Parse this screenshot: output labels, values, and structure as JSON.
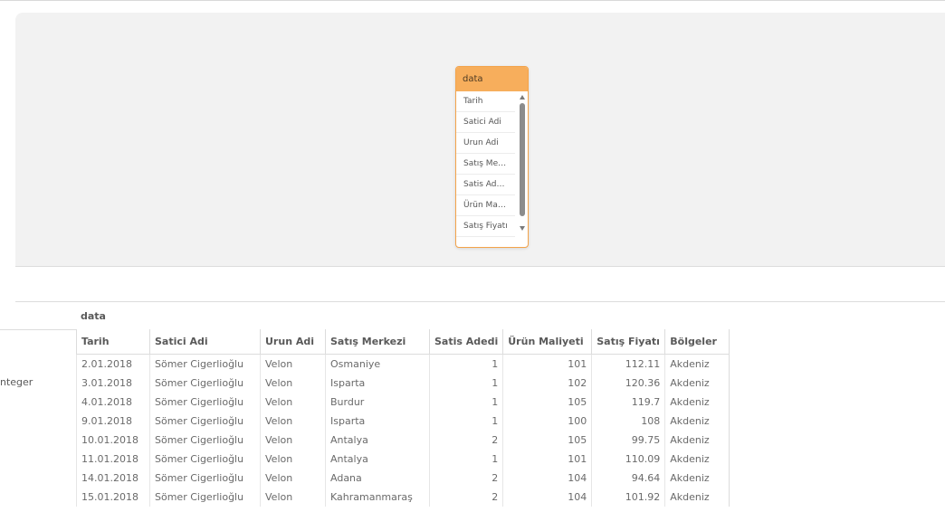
{
  "model_viewer": {
    "table": {
      "name": "data",
      "fields": [
        "Tarih",
        "Satici Adi",
        "Urun Adi",
        "Satış Me…",
        "Satis Ad…",
        "Ürün Ma…",
        "Satış Fiyatı"
      ]
    }
  },
  "preview": {
    "field_type": "nteger",
    "table_name": "data",
    "columns": [
      "Tarih",
      "Satici Adi",
      "Urun Adi",
      "Satış Merkezi",
      "Satis Adedi",
      "Ürün Maliyeti",
      "Satış Fiyatı",
      "Bölgeler"
    ],
    "rows": [
      [
        "2.01.2018",
        "Sömer Cigerlioğlu",
        "Velon",
        "Osmaniye",
        "1",
        "101",
        "112.11",
        "Akdeniz"
      ],
      [
        "3.01.2018",
        "Sömer Cigerlioğlu",
        "Velon",
        "Isparta",
        "1",
        "102",
        "120.36",
        "Akdeniz"
      ],
      [
        "4.01.2018",
        "Sömer Cigerlioğlu",
        "Velon",
        "Burdur",
        "1",
        "105",
        "119.7",
        "Akdeniz"
      ],
      [
        "9.01.2018",
        "Sömer Cigerlioğlu",
        "Velon",
        "Isparta",
        "1",
        "100",
        "108",
        "Akdeniz"
      ],
      [
        "10.01.2018",
        "Sömer Cigerlioğlu",
        "Velon",
        "Antalya",
        "2",
        "105",
        "99.75",
        "Akdeniz"
      ],
      [
        "11.01.2018",
        "Sömer Cigerlioğlu",
        "Velon",
        "Antalya",
        "1",
        "101",
        "110.09",
        "Akdeniz"
      ],
      [
        "14.01.2018",
        "Sömer Cigerlioğlu",
        "Velon",
        "Adana",
        "2",
        "104",
        "94.64",
        "Akdeniz"
      ],
      [
        "15.01.2018",
        "Sömer Cigerlioğlu",
        "Velon",
        "Kahramanmaraş",
        "2",
        "104",
        "101.92",
        "Akdeniz"
      ]
    ]
  },
  "colors": {
    "table_header": "#f7ae5c",
    "table_border": "#f3a34a",
    "canvas_bg": "#f2f2f2"
  }
}
